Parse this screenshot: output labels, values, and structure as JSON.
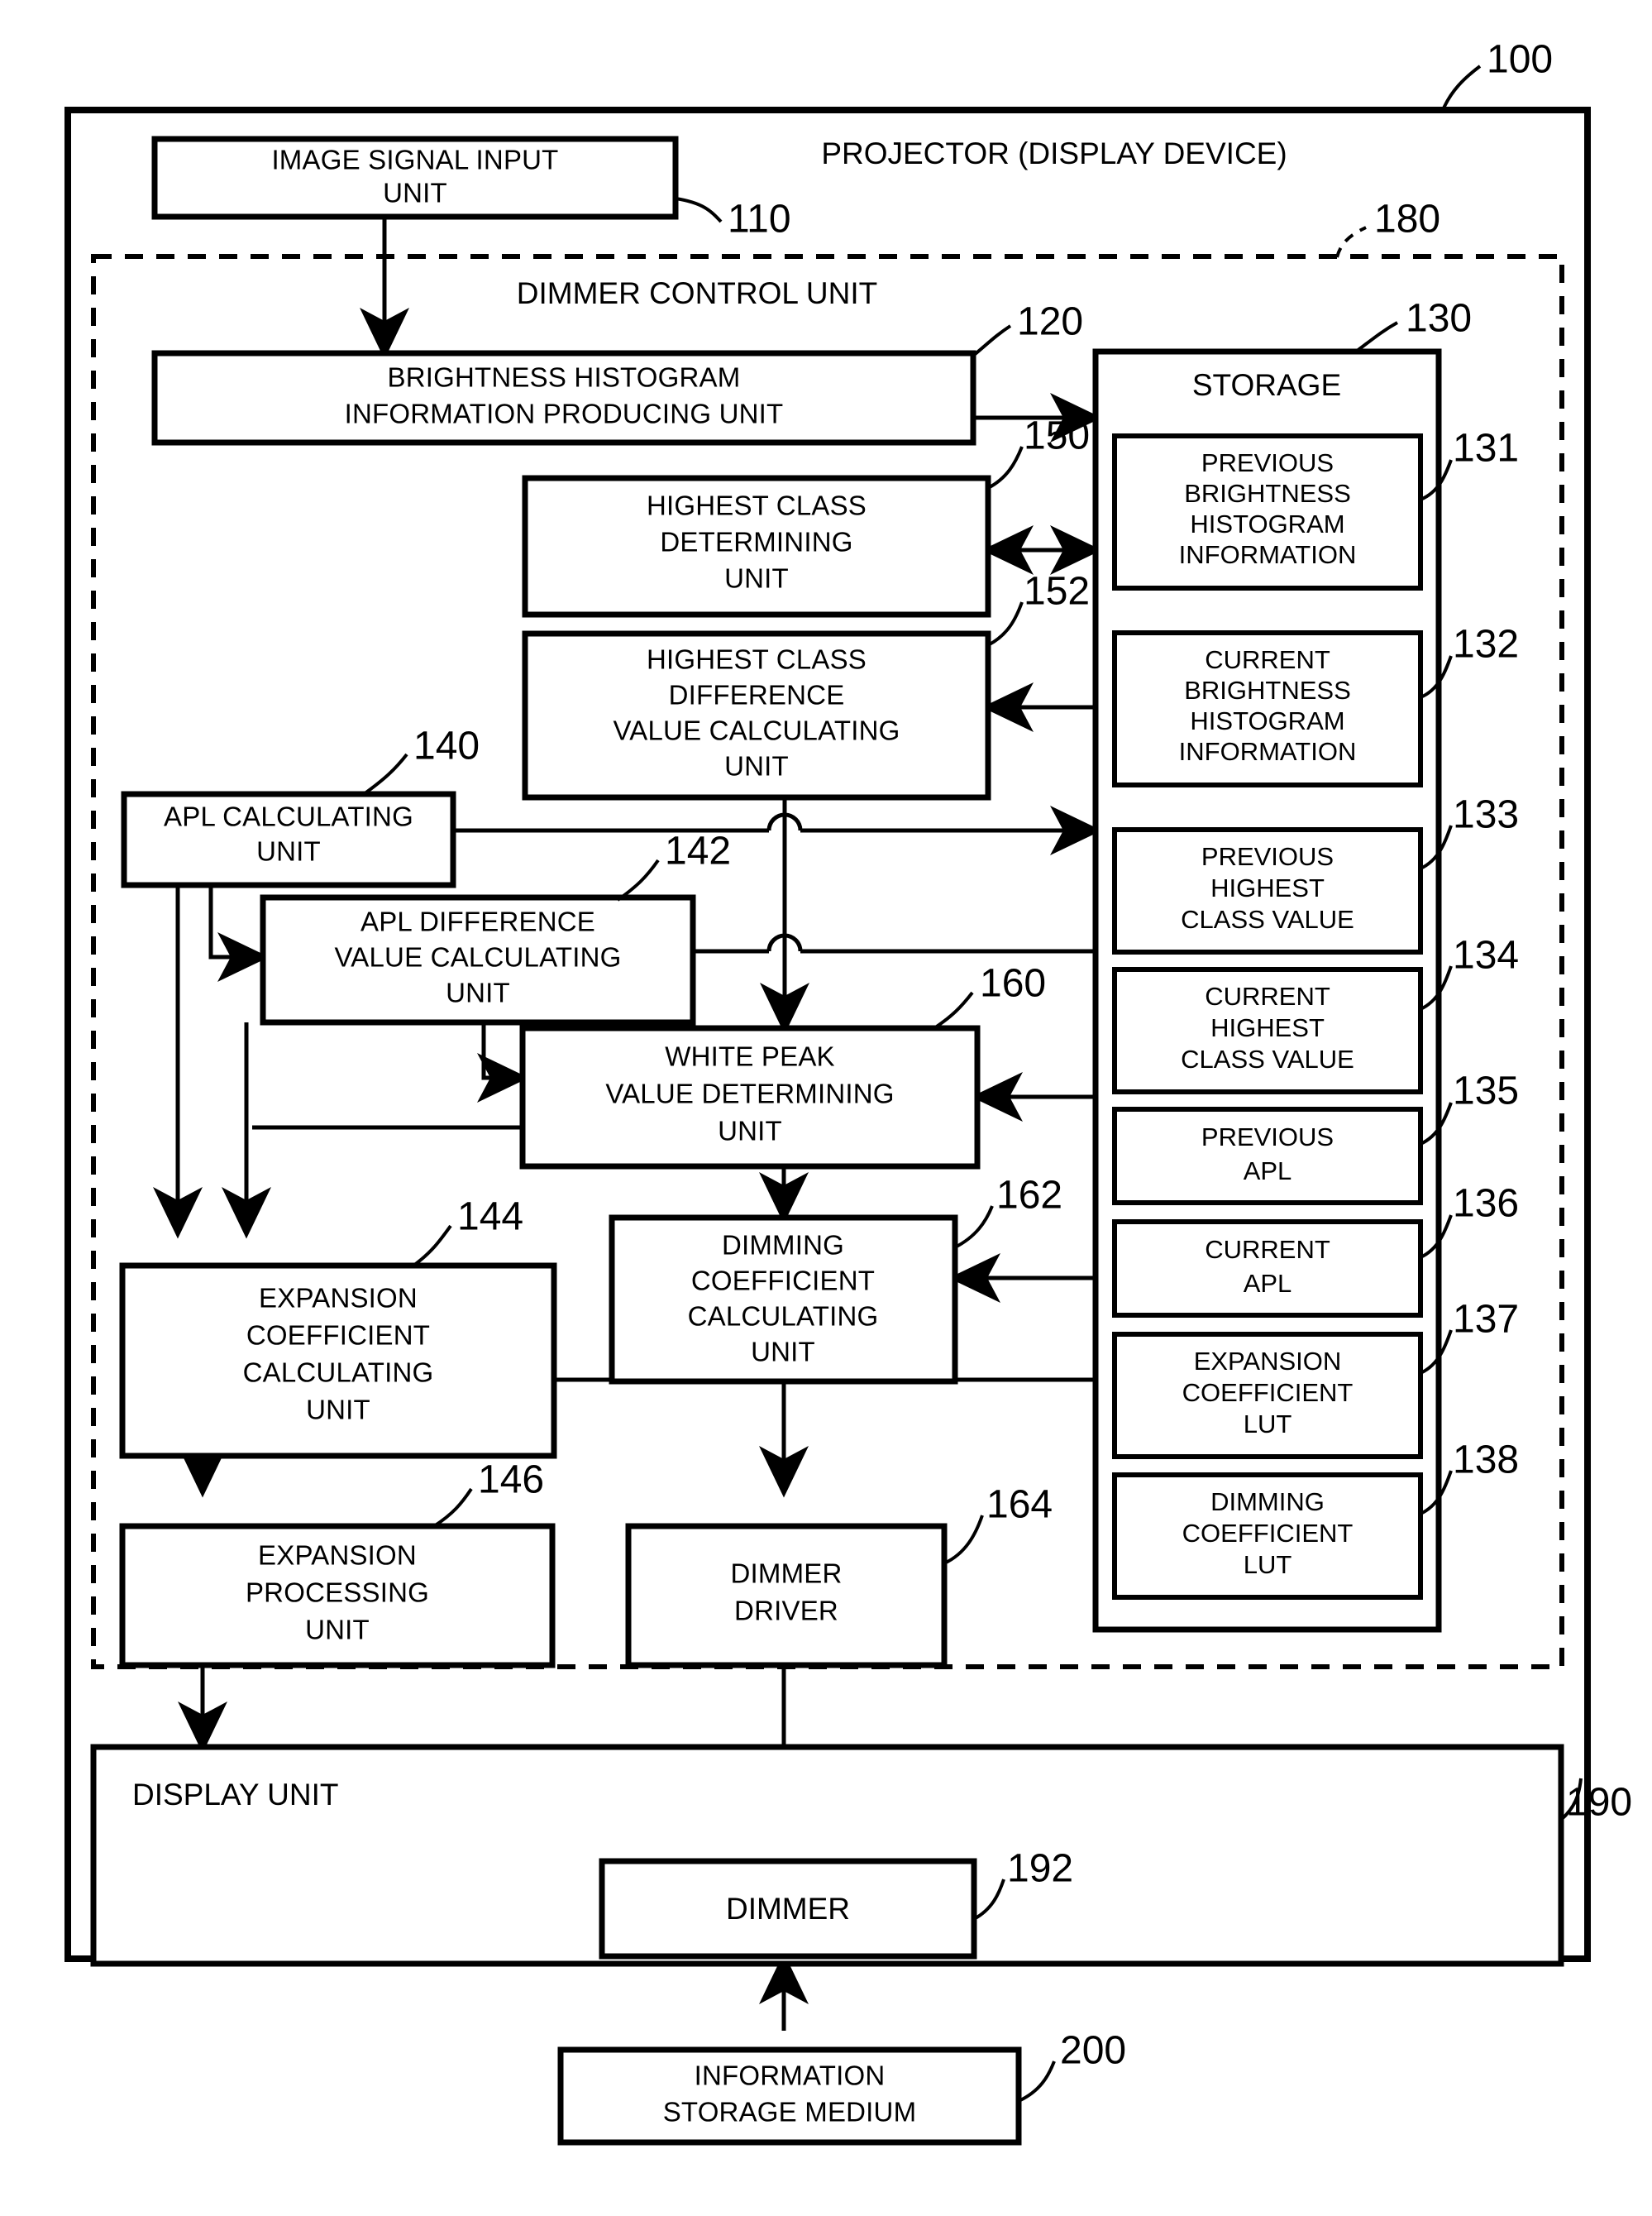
{
  "figure": {
    "outer_label": "100",
    "outer_title": "PROJECTOR (DISPLAY DEVICE)",
    "dimmer_control_label": "180",
    "dimmer_control_title": "DIMMER CONTROL UNIT"
  },
  "blocks": {
    "image_signal_input": {
      "label": "IMAGE SIGNAL INPUT\nUNIT",
      "line1": "IMAGE SIGNAL INPUT",
      "line2": "UNIT",
      "ref": "110"
    },
    "brightness_histogram": {
      "line1": "BRIGHTNESS HISTOGRAM",
      "line2": "INFORMATION PRODUCING UNIT",
      "ref": "120"
    },
    "storage": {
      "title": "STORAGE",
      "ref": "130"
    },
    "highest_class_determining": {
      "line1": "HIGHEST CLASS",
      "line2": "DETERMINING",
      "line3": "UNIT",
      "ref": "150"
    },
    "highest_class_difference": {
      "line1": "HIGHEST CLASS",
      "line2": "DIFFERENCE",
      "line3": "VALUE CALCULATING",
      "line4": "UNIT",
      "ref": "152"
    },
    "apl_calculating": {
      "line1": "APL CALCULATING",
      "line2": "UNIT",
      "ref": "140"
    },
    "apl_difference": {
      "line1": "APL DIFFERENCE",
      "line2": "VALUE CALCULATING",
      "line3": "UNIT",
      "ref": "142"
    },
    "white_peak": {
      "line1": "WHITE PEAK",
      "line2": "VALUE DETERMINING",
      "line3": "UNIT",
      "ref": "160"
    },
    "dimming_coefficient_calculating": {
      "line1": "DIMMING",
      "line2": "COEFFICIENT",
      "line3": "CALCULATING",
      "line4": "UNIT",
      "ref": "162"
    },
    "expansion_coefficient_calculating": {
      "line1": "EXPANSION",
      "line2": "COEFFICIENT",
      "line3": "CALCULATING",
      "line4": "UNIT",
      "ref": "144"
    },
    "expansion_processing": {
      "line1": "EXPANSION",
      "line2": "PROCESSING",
      "line3": "UNIT",
      "ref": "146"
    },
    "dimmer_driver": {
      "line1": "DIMMER",
      "line2": "DRIVER",
      "ref": "164"
    },
    "display_unit": {
      "title": "DISPLAY UNIT",
      "ref": "190"
    },
    "dimmer": {
      "title": "DIMMER",
      "ref": "192"
    },
    "information_storage_medium": {
      "line1": "INFORMATION",
      "line2": "STORAGE MEDIUM",
      "ref": "200"
    }
  },
  "storage_items": [
    {
      "ref": "131",
      "lines": [
        "PREVIOUS",
        "BRIGHTNESS",
        "HISTOGRAM",
        "INFORMATION"
      ]
    },
    {
      "ref": "132",
      "lines": [
        "CURRENT",
        "BRIGHTNESS",
        "HISTOGRAM",
        "INFORMATION"
      ]
    },
    {
      "ref": "133",
      "lines": [
        "PREVIOUS",
        "HIGHEST",
        "CLASS VALUE"
      ]
    },
    {
      "ref": "134",
      "lines": [
        "CURRENT",
        "HIGHEST",
        "CLASS VALUE"
      ]
    },
    {
      "ref": "135",
      "lines": [
        "PREVIOUS",
        "APL"
      ]
    },
    {
      "ref": "136",
      "lines": [
        "CURRENT",
        "APL"
      ]
    },
    {
      "ref": "137",
      "lines": [
        "EXPANSION",
        "COEFFICIENT",
        "LUT"
      ]
    },
    {
      "ref": "138",
      "lines": [
        "DIMMING",
        "COEFFICIENT",
        "LUT"
      ]
    }
  ],
  "colors": {
    "stroke": "#000000",
    "background": "#ffffff"
  }
}
